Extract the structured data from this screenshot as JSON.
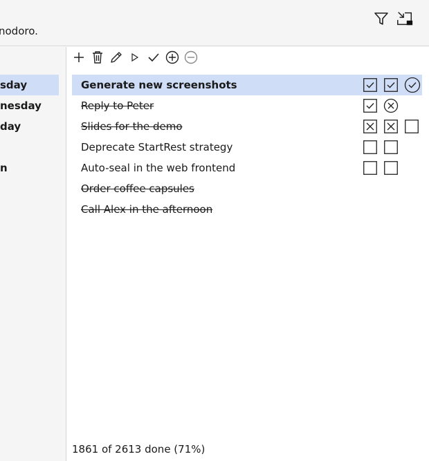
{
  "header": {
    "hint_text": "nodoro.",
    "filter_icon": "filter-icon",
    "compact_icon": "compact-view-icon"
  },
  "sidebar": {
    "items": [
      {
        "label": "sday",
        "selected": true
      },
      {
        "label": "nesday",
        "selected": false
      },
      {
        "label": "day",
        "selected": false
      },
      {
        "label": "n",
        "selected": false
      }
    ]
  },
  "toolbar": {
    "buttons": [
      "add-icon",
      "delete-icon",
      "edit-icon",
      "start-icon",
      "complete-icon",
      "add-subtask-icon",
      "remove-icon"
    ]
  },
  "tasks": [
    {
      "title": "Generate new screenshots",
      "done": false,
      "selected": true,
      "bold": true,
      "pomodoros": [
        "done",
        "done",
        "done-circle"
      ]
    },
    {
      "title": "Reply to Peter",
      "done": true,
      "selected": false,
      "bold": false,
      "pomodoros": [
        "done",
        "void-circle"
      ]
    },
    {
      "title": "Slides for the demo",
      "done": true,
      "selected": false,
      "bold": false,
      "pomodoros": [
        "void",
        "void",
        "empty"
      ]
    },
    {
      "title": "Deprecate StartRest strategy",
      "done": false,
      "selected": false,
      "bold": false,
      "pomodoros": [
        "empty",
        "empty"
      ]
    },
    {
      "title": "Auto-seal in the web frontend",
      "done": false,
      "selected": false,
      "bold": false,
      "pomodoros": [
        "empty",
        "empty"
      ]
    },
    {
      "title": "Order coffee capsules",
      "done": true,
      "selected": false,
      "bold": false,
      "pomodoros": []
    },
    {
      "title": "Call Alex in the afternoon",
      "done": true,
      "selected": false,
      "bold": false,
      "pomodoros": []
    }
  ],
  "status": {
    "text": "1861 of 2613 done (71%)"
  },
  "colors": {
    "selection": "#cfddf7",
    "panel": "#f5f5f5",
    "border": "#d4d4d4"
  }
}
